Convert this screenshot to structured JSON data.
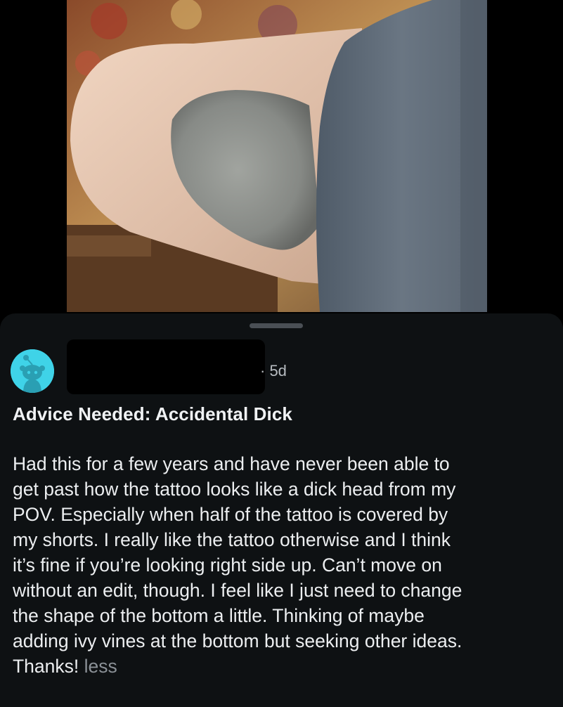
{
  "post": {
    "time": "· 5d",
    "title": "Advice Needed: Accidental Dick",
    "body_lines": [
      "Had this for a few years and have never been able to",
      "get past how the tattoo looks like a dick head from my",
      "POV. Especially when half of the tattoo is covered by",
      "my shorts. I really like the tattoo otherwise and I think",
      "it’s fine if you’re looking right side up. Can’t move on",
      "without an edit, though. I feel like I just need to change",
      "the shape of the bottom a little. Thinking of maybe",
      "adding ivy vines at the bottom but seeking other ideas.",
      "Thanks!"
    ],
    "less_label": "less"
  },
  "icons": {
    "avatar": "reddit-snoo-avatar-icon"
  },
  "colors": {
    "sheet_bg": "#0e1113",
    "avatar_bg": "#3fd3e8",
    "muted_text": "#8b9197"
  }
}
